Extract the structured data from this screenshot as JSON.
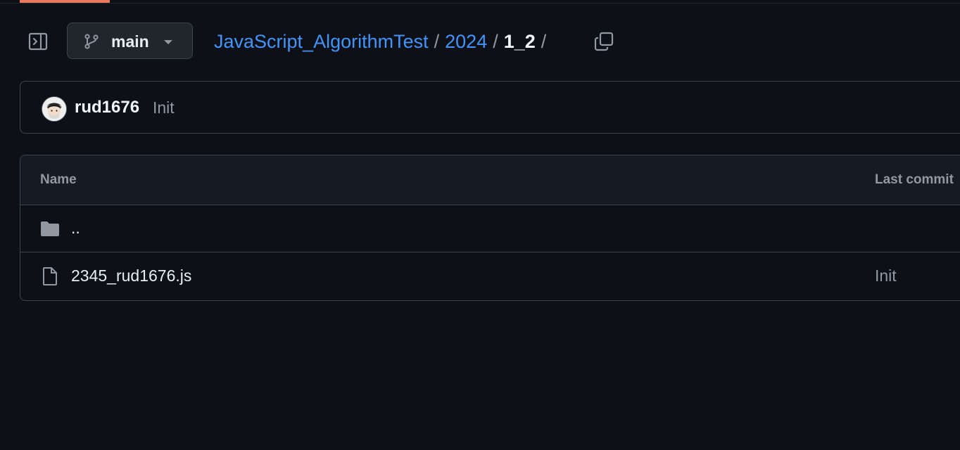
{
  "theme": {
    "bg": "#0d1117",
    "link": "#4493f8",
    "muted": "#9198a1",
    "border": "#3d444d",
    "accent": "#e8765e"
  },
  "branch": {
    "name": "main",
    "icon": "git-branch-icon"
  },
  "breadcrumb": {
    "repo": "JavaScript_AlgorithmTest",
    "folder": "2024",
    "current": "1_2",
    "separator": "/"
  },
  "latest_commit": {
    "author": "rud1676",
    "message": "Init"
  },
  "table": {
    "headers": {
      "name": "Name",
      "last_commit": "Last commit"
    },
    "rows": [
      {
        "type": "folder",
        "icon": "folder-icon",
        "name": "..",
        "last_commit": ""
      },
      {
        "type": "file",
        "icon": "file-icon",
        "name": "2345_rud1676.js",
        "last_commit": "Init"
      }
    ]
  }
}
